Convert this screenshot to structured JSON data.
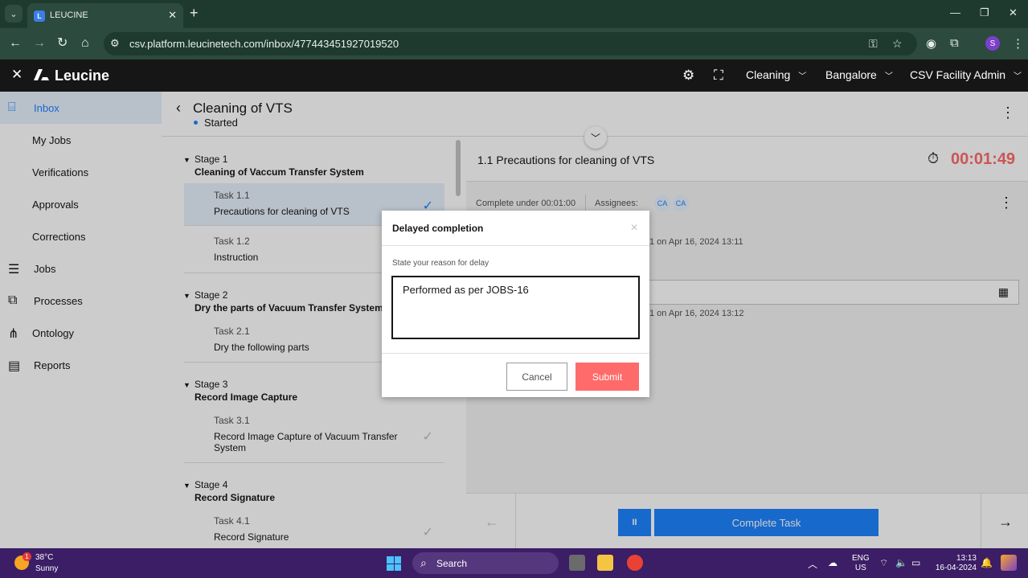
{
  "browser": {
    "tab_title": "LEUCINE",
    "tab_favicon": "L",
    "url": "csv.platform.leucinetech.com/inbox/477443451927019520",
    "profile_initial": "S"
  },
  "app": {
    "logo_text": "Leucine",
    "use_case": "Cleaning",
    "facility": "Bangalore",
    "user_role": "CSV Facility Admin"
  },
  "sidebar": {
    "items": [
      {
        "label": "Inbox"
      },
      {
        "label": "My Jobs"
      },
      {
        "label": "Verifications"
      },
      {
        "label": "Approvals"
      },
      {
        "label": "Corrections"
      },
      {
        "label": "Jobs"
      },
      {
        "label": "Processes"
      },
      {
        "label": "Ontology"
      },
      {
        "label": "Reports"
      }
    ]
  },
  "job": {
    "title": "Cleaning of VTS",
    "status": "Started"
  },
  "stages": [
    {
      "number": "Stage 1",
      "name": "Cleaning of Vaccum Transfer System",
      "tasks": [
        {
          "number": "Task 1.1",
          "name": "Precautions for cleaning of VTS"
        },
        {
          "number": "Task 1.2",
          "name": "Instruction"
        }
      ]
    },
    {
      "number": "Stage 2",
      "name": "Dry the parts of Vacuum Transfer System",
      "tasks": [
        {
          "number": "Task 2.1",
          "name": "Dry the following parts"
        }
      ]
    },
    {
      "number": "Stage 3",
      "name": "Record Image Capture",
      "tasks": [
        {
          "number": "Task 3.1",
          "name": "Record Image Capture of Vacuum Transfer System"
        }
      ]
    },
    {
      "number": "Stage 4",
      "name": "Record Signature",
      "tasks": [
        {
          "number": "Task 4.1",
          "name": "Record Signature"
        }
      ]
    }
  ],
  "task_detail": {
    "title": "1.1 Precautions for cleaning of VTS",
    "timer": "00:01:49",
    "complete_under": "Complete under 00:01:00",
    "assignees_label": "Assignees:",
    "assignees": [
      "CA",
      "CA"
    ],
    "history_1": "1 on Apr 16, 2024 13:11",
    "history_2": "1 on Apr 16, 2024 13:12"
  },
  "footer": {
    "pause_label": "II",
    "complete_label": "Complete Task"
  },
  "modal": {
    "title": "Delayed completion",
    "field_label": "State your reason for delay",
    "reason_value": "Performed as per JOBS-16",
    "cancel_label": "Cancel",
    "submit_label": "Submit"
  },
  "taskbar": {
    "temperature": "38°C",
    "weather": "Sunny",
    "weather_badge": "1",
    "search_label": "Search",
    "lang_1": "ENG",
    "lang_2": "US",
    "time": "13:13",
    "date": "16-04-2024"
  },
  "colors": {
    "accent": "#1d84ff",
    "danger": "#ff6b6b",
    "header_bg": "#161616",
    "taskbar_bg": "#3b1e66"
  }
}
